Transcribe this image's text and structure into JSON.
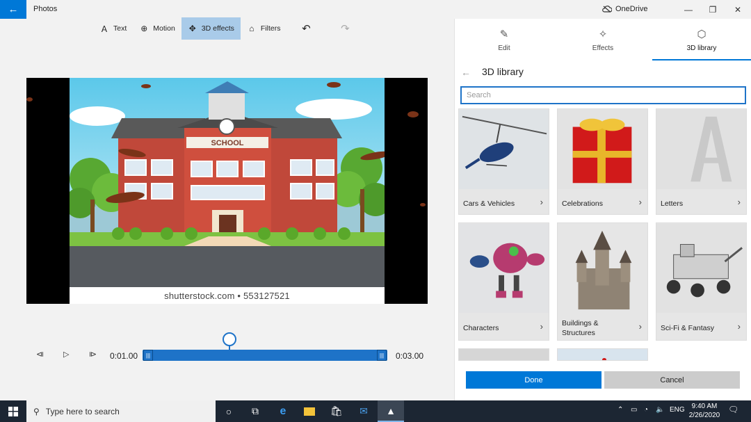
{
  "app": {
    "title": "Photos",
    "onedrive_label": "OneDrive"
  },
  "toolbar": {
    "text_label": "Text",
    "motion_label": "Motion",
    "effects3d_label": "3D effects",
    "filters_label": "Filters"
  },
  "preview": {
    "watermark": "shutterstock.com • 553127521",
    "sign_text": "SCHOOL"
  },
  "playback": {
    "current_time": "0:01.00",
    "end_time": "0:03.00"
  },
  "panel": {
    "tabs": [
      {
        "label": "Edit",
        "icon": "pencil-icon"
      },
      {
        "label": "Effects",
        "icon": "sparkle-icon"
      },
      {
        "label": "3D library",
        "icon": "cube-icon"
      }
    ],
    "library_title": "3D library",
    "search_placeholder": "Search",
    "categories": [
      {
        "label": "Cars & Vehicles"
      },
      {
        "label": "Celebrations"
      },
      {
        "label": "Letters"
      },
      {
        "label": "Characters"
      },
      {
        "label": "Buildings &\nStructures"
      },
      {
        "label": "Sci-Fi & Fantasy"
      }
    ],
    "done_label": "Done",
    "cancel_label": "Cancel"
  },
  "taskbar": {
    "search_placeholder": "Type here to search",
    "lang": "ENG",
    "time": "9:40 AM",
    "date": "2/26/2020"
  },
  "colors": {
    "accent": "#0078d7",
    "active_tool": "#a9cbe9",
    "taskbar": "#1c2633"
  }
}
